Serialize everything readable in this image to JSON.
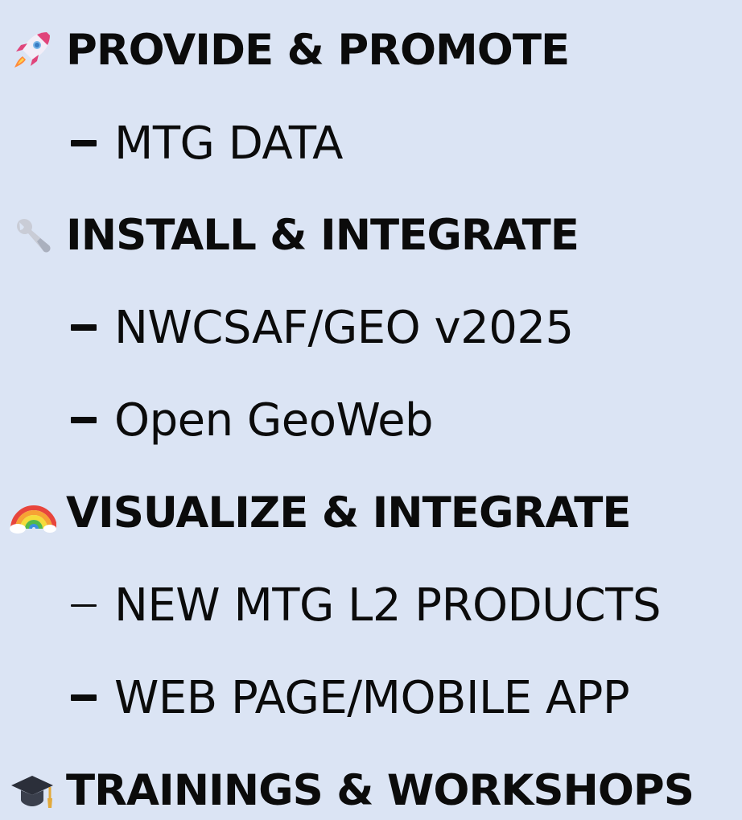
{
  "sections": [
    {
      "title": "PROVIDE & PROMOTE",
      "icon": "rocket-icon",
      "items": [
        "MTG DATA"
      ]
    },
    {
      "title": "INSTALL & INTEGRATE",
      "icon": "wrench-icon",
      "items": [
        "NWCSAF/GEO v2025",
        "Open GeoWeb"
      ]
    },
    {
      "title": "VISUALIZE & INTEGRATE",
      "icon": "rainbow-icon",
      "items": [
        "NEW MTG L2 PRODUCTS",
        "WEB PAGE/MOBILE APP"
      ]
    },
    {
      "title": "TRAININGS & WORKSHOPS",
      "icon": "graduation-cap-icon",
      "items": []
    }
  ],
  "colors": {
    "background": "#dbe4f4",
    "text": "#0b0b0b"
  }
}
